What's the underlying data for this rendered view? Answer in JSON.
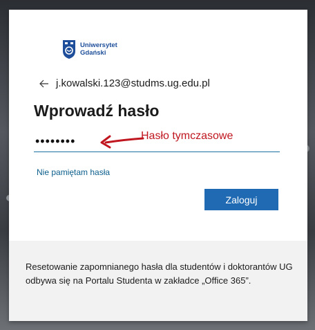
{
  "brand": {
    "line1": "Uniwersytet",
    "line2": "Gdański",
    "mark_letters": "UG",
    "color": "#1f4f9b"
  },
  "account": {
    "email": "j.kowalski.123@studms.ug.edu.pl"
  },
  "login": {
    "title": "Wprowadź hasło",
    "password_masked": "••••••••",
    "annotation": "Hasło tymczasowe",
    "forgot_link": "Nie pamiętam hasła",
    "signin_label": "Zaloguj"
  },
  "footer": {
    "text": "Resetowanie zapomnianego hasła dla studentów i doktorantów UG odbywa się na Portalu Studenta w zakładce „Office 365”."
  },
  "colors": {
    "accent": "#1f6ab3",
    "link": "#0b5e8c",
    "annotation": "#c0161f",
    "footer_bg": "#f2f2f2"
  },
  "icons": {
    "back": "arrow-left-icon",
    "logo": "university-logo-icon",
    "annotation": "hand-drawn-arrow-icon"
  }
}
